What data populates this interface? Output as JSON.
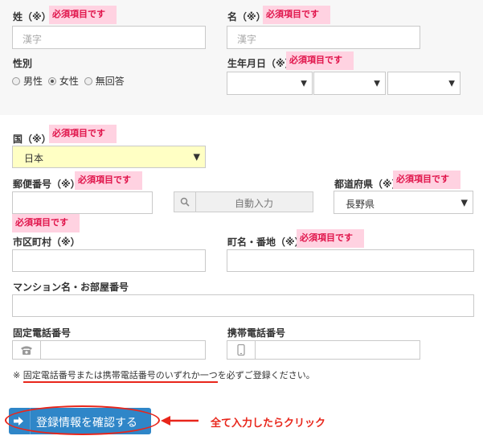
{
  "required_tag": "必須項目です",
  "sei": {
    "label": "姓（※）",
    "placeholder": "漢字"
  },
  "mei": {
    "label": "名（※）",
    "placeholder": "漢字"
  },
  "gender": {
    "label": "性別",
    "options": [
      "男性",
      "女性",
      "無回答"
    ],
    "selected": "女性"
  },
  "birthday": {
    "label": "生年月日（※）"
  },
  "country": {
    "label": "国（※）",
    "value": "日本"
  },
  "postal": {
    "label": "郵便番号（※）",
    "auto_button": "自動入力"
  },
  "prefecture": {
    "label": "都道府県（※）",
    "value": "長野県"
  },
  "city": {
    "label": "市区町村（※）"
  },
  "town": {
    "label": "町名・番地（※）"
  },
  "building": {
    "label": "マンション名・お部屋番号"
  },
  "landline": {
    "label": "固定電話番号"
  },
  "mobile": {
    "label": "携帯電話番号"
  },
  "phone_note": {
    "prefix": "※ ",
    "underlined": "固定電話番号または携帯電話番号のいずれか一つ",
    "suffix": "を必ずご登録ください。"
  },
  "submit": {
    "label": "登録情報を確認する"
  },
  "annotation": {
    "text": "全て入力したらクリック"
  },
  "colors": {
    "required_bg": "#ffd2e1",
    "required_text": "#e0134a",
    "annotation_red": "#e8261b",
    "submit_blue": "#2f86c8",
    "country_select_bg": "#ffffc4"
  }
}
